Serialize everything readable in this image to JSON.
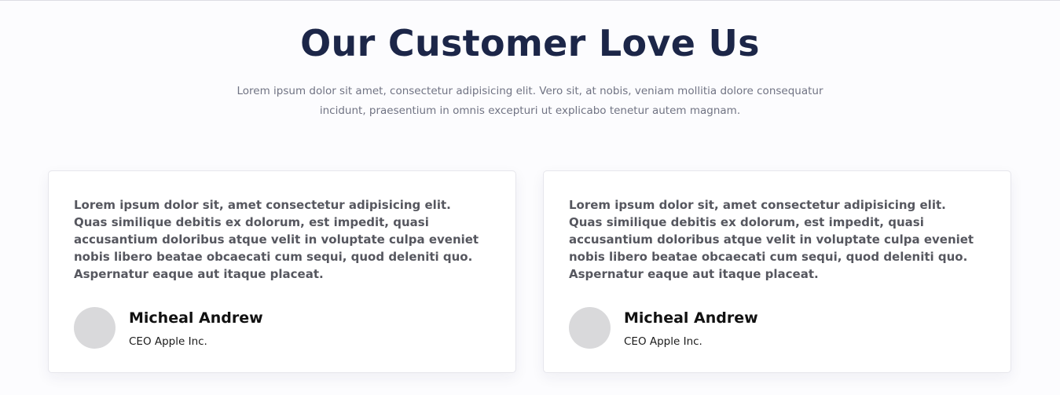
{
  "section": {
    "title": "Our Customer Love Us",
    "subtitle": "Lorem ipsum dolor sit amet, consectetur adipisicing elit. Vero sit, at nobis, veniam mollitia dolore consequatur incidunt, praesentium in omnis excepturi ut explicabo tenetur autem magnam."
  },
  "testimonials": [
    {
      "quote": "Lorem ipsum dolor sit, amet consectetur adipisicing elit. Quas similique debitis ex dolorum, est impedit, quasi accusantium doloribus atque velit in voluptate culpa eveniet nobis libero beatae obcaecati cum sequi, quod deleniti quo. Aspernatur eaque aut itaque placeat.",
      "name": "Micheal Andrew",
      "role": "CEO Apple Inc."
    },
    {
      "quote": "Lorem ipsum dolor sit, amet consectetur adipisicing elit. Quas similique debitis ex dolorum, est impedit, quasi accusantium doloribus atque velit in voluptate culpa eveniet nobis libero beatae obcaecati cum sequi, quod deleniti quo. Aspernatur eaque aut itaque placeat.",
      "name": "Micheal Andrew",
      "role": "CEO Apple Inc."
    }
  ],
  "colors": {
    "title": "#1c2648",
    "subtitle": "#707383",
    "quote": "#56575f",
    "avatar_placeholder": "#d9d9db",
    "card_background": "#ffffff",
    "page_background": "#fcfcfe"
  }
}
